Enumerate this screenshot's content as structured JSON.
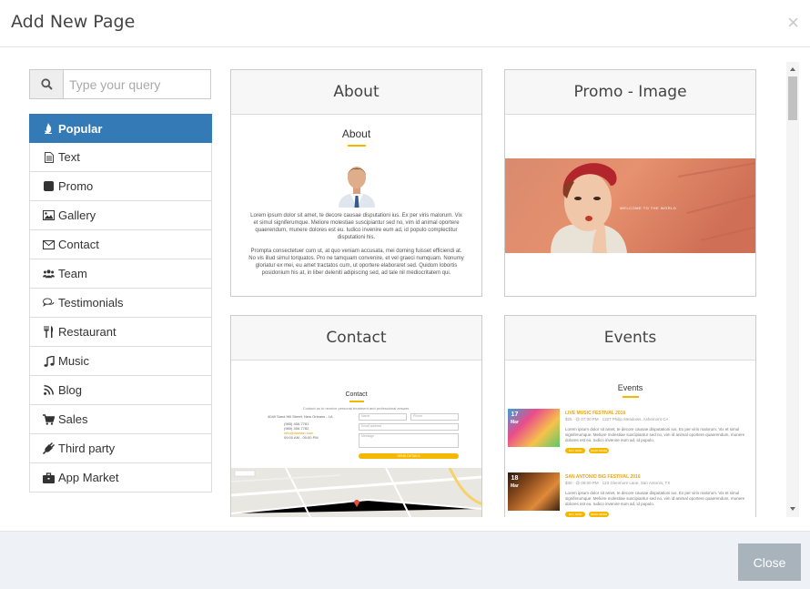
{
  "header": {
    "title": "Add New Page",
    "close_glyph": "×"
  },
  "search": {
    "placeholder": "Type your query",
    "value": "",
    "icon": "search-icon"
  },
  "categories": [
    {
      "label": "Popular",
      "icon": "fire-icon",
      "active": true
    },
    {
      "label": "Text",
      "icon": "file-text-icon"
    },
    {
      "label": "Promo",
      "icon": "square-icon"
    },
    {
      "label": "Gallery",
      "icon": "image-icon"
    },
    {
      "label": "Contact",
      "icon": "envelope-icon"
    },
    {
      "label": "Team",
      "icon": "users-icon"
    },
    {
      "label": "Testimonials",
      "icon": "comments-icon"
    },
    {
      "label": "Restaurant",
      "icon": "cutlery-icon"
    },
    {
      "label": "Music",
      "icon": "music-icon"
    },
    {
      "label": "Blog",
      "icon": "rss-icon"
    },
    {
      "label": "Sales",
      "icon": "cart-icon"
    },
    {
      "label": "Third party",
      "icon": "plug-icon"
    },
    {
      "label": "App Market",
      "icon": "briefcase-icon"
    }
  ],
  "cards": {
    "about": {
      "title": "About",
      "preview_title": "About",
      "para1": "Lorem ipsum dolor sit amet, te decore causae disputationi ius. Ex per viris malorum. Vix et simul signiferumque. Meliore molestiae suscipiantur sed no, vim id animal oportere quaerendum, munere dolores est eu. Iudico invenire eum ad, id populo complectitur disputationi his.",
      "para2": "Prompta consectetuer cum ut, at quo veniam accusata, mei doming fuisset efficiendi at. No vis illud simul torquatos. Pro ne tamquam convenire, et vel graeci numquam. Nonumy gloriatur ex mei, eu amet tractatos cum, ut oportere elaboraret sed. Quidom lobortis posidonium his at, in liber deleniti adipiscing sed, ad tale nil mediocritatem qui."
    },
    "promo": {
      "title": "Promo - Image",
      "overlay_text": "WELCOME TO THE WORLD"
    },
    "contact": {
      "title": "Contact",
      "preview_title": "Contact",
      "intro": "Contact us to receive personal treatment and professional answer.",
      "address": "4049 Sand Hill Street, New Orleans - LA",
      "phone1": "(985) 456-7781",
      "phone2": "(985) 456-7782",
      "email": "info@domain.com",
      "hours": "09:00 AM - 05:00 PM",
      "field_name": "Name",
      "field_phone": "Phone",
      "field_email": "Email address",
      "field_message": "Message",
      "send_label": "SEND DETAILS"
    },
    "events": {
      "title": "Events",
      "preview_title": "Events",
      "items": [
        {
          "day": "17",
          "month": "Mar",
          "name": "LIVE MUSIC FESTIVAL 2016",
          "meta": "$25  ·  @ 07:00 PM  ·  1327 Philip Meadows, Ashemont CA",
          "text": "Lorem ipsum dolor sit amet, te decore causae disputationi ius. Ex per viris malorum. Vix et simul signiferumque. Meliore molestiae suscipiantur sed no, vim id animal oportere quaerendum, munere dolores est eu. Iudico invenire eum ad, id populo.",
          "btn1": "BUY NOW",
          "btn2": "READ MORE"
        },
        {
          "day": "18",
          "month": "Mar",
          "name": "SAN ANTONIO BIG FESTIVAL 2016",
          "meta": "$30  ·  @ 09:00 PM  ·  123 Glenmore Lane, San Antonio, TX",
          "text": "Lorem ipsum dolor sit amet, te decore causae disputationi ius. Ex per viris malorum. Vix et simul signiferumque. Meliore molestiae suscipiantur sed no, vim id animal oportere quaerendum, munere dolores est eu. Iudico invenire eum ad, id populo.",
          "btn1": "BUY NOW",
          "btn2": "READ MORE"
        }
      ]
    }
  },
  "footer": {
    "close_label": "Close"
  },
  "colors": {
    "accent": "#337ab7",
    "highlight": "#f5b800",
    "close_button": "#a8b3bc",
    "footer_bg": "#eef1f6"
  }
}
